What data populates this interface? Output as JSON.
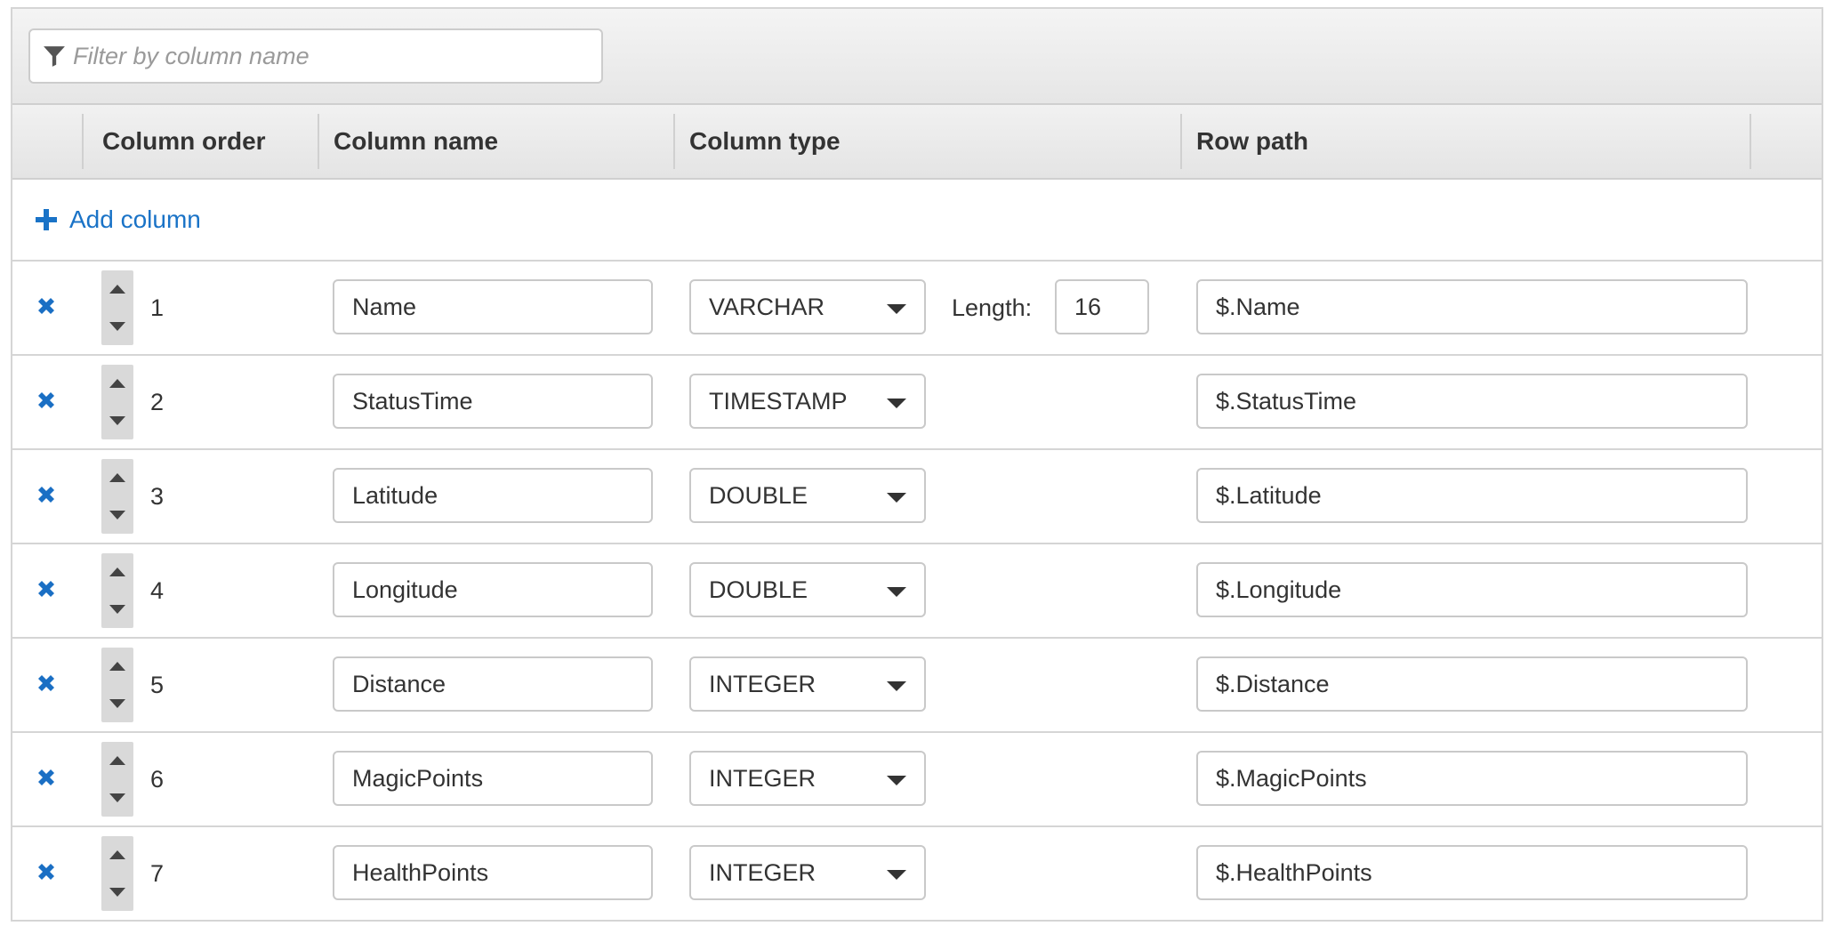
{
  "filter": {
    "placeholder": "Filter by column name",
    "icon": "filter-icon"
  },
  "headers": {
    "column_order": "Column order",
    "column_name": "Column name",
    "column_type": "Column type",
    "row_path": "Row path"
  },
  "add_column": {
    "label": "Add column",
    "icon": "plus-icon"
  },
  "length_label": "Length:",
  "colors": {
    "link": "#1a73c7",
    "delete_icon": "#1a6fc4",
    "header_bg": "#e8e8e8",
    "border": "#d5d5d5"
  },
  "rows": [
    {
      "order": "1",
      "name": "Name",
      "type": "VARCHAR",
      "length": "16",
      "path": "$.Name"
    },
    {
      "order": "2",
      "name": "StatusTime",
      "type": "TIMESTAMP",
      "path": "$.StatusTime"
    },
    {
      "order": "3",
      "name": "Latitude",
      "type": "DOUBLE",
      "path": "$.Latitude"
    },
    {
      "order": "4",
      "name": "Longitude",
      "type": "DOUBLE",
      "path": "$.Longitude"
    },
    {
      "order": "5",
      "name": "Distance",
      "type": "INTEGER",
      "path": "$.Distance"
    },
    {
      "order": "6",
      "name": "MagicPoints",
      "type": "INTEGER",
      "path": "$.MagicPoints"
    },
    {
      "order": "7",
      "name": "HealthPoints",
      "type": "INTEGER",
      "path": "$.HealthPoints"
    }
  ]
}
